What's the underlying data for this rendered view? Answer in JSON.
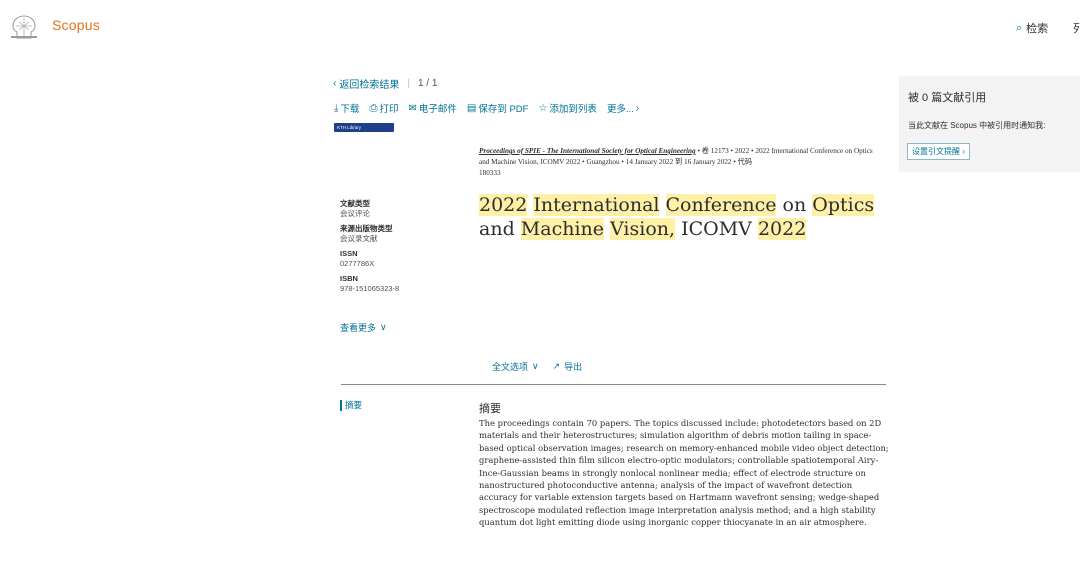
{
  "header": {
    "brand": "Scopus",
    "search_label": "检索",
    "lists_label": "列"
  },
  "nav": {
    "back_label": "返回检索结果",
    "pager": "1 / 1"
  },
  "actions": {
    "download": "下载",
    "print": "打印",
    "email": "电子邮件",
    "save_pdf": "保存到 PDF",
    "add_list": "添加到列表",
    "more": "更多..."
  },
  "library_badge": "KTH Library",
  "source": {
    "journal": "Proceedings of SPIE - The International Society for Optical Engineering",
    "volume": "卷 12173",
    "year": "2022",
    "conference": "2022 International Conference on Optics and Machine Vision, ICOMV 2022",
    "location": "Guangzhou",
    "dates": "14 January 2022 到 16 January 2022",
    "code_label": "代码",
    "code": "180333"
  },
  "title_words": [
    "2022",
    "International",
    "Conference",
    "on",
    "Optics",
    "and",
    "Machine",
    "Vision,",
    "ICOMV",
    "2022"
  ],
  "meta": {
    "doc_type_label": "文献类型",
    "doc_type": "会议评论",
    "source_type_label": "来源出版物类型",
    "source_type": "会议录文献",
    "issn_label": "ISSN",
    "issn": "0277786X",
    "isbn_label": "ISBN",
    "isbn": "978-151065323-8",
    "more_label": "查看更多"
  },
  "fulltext": {
    "options_label": "全文选项",
    "export_label": "导出"
  },
  "abstract": {
    "tab_label": "摘要",
    "heading": "摘要",
    "text": "The proceedings contain 70 papers. The topics discussed include: photodetectors based on 2D materials and their heterostructures; simulation algorithm of debris motion tailing in space-based optical observation images; research on memory-enhanced mobile video object detection; graphene-assisted thin film silicon electro-optic modulators; controllable spatiotemporal Airy-Ince-Gaussian beams in strongly nonlocal nonlinear media; effect of electrode structure on nanostructured photoconductive antenna; analysis of the impact of wavefront detection accuracy for variable extension targets based on Hartmann wavefront sensing; wedge-shaped spectroscope modulated reflection image interpretation analysis method; and a high stability quantum dot light emitting diode using inorganic copper thiocyanate in an air atmosphere."
  },
  "citations": {
    "title": "被 0 篇文献引用",
    "note": "当此文献在 Scopus 中被引用时通知我:",
    "button": "设置引文提醒"
  },
  "colors": {
    "brand": "#e9711c",
    "link": "#007398",
    "highlight": "#fff0a8",
    "panel": "#f3f3f3"
  }
}
